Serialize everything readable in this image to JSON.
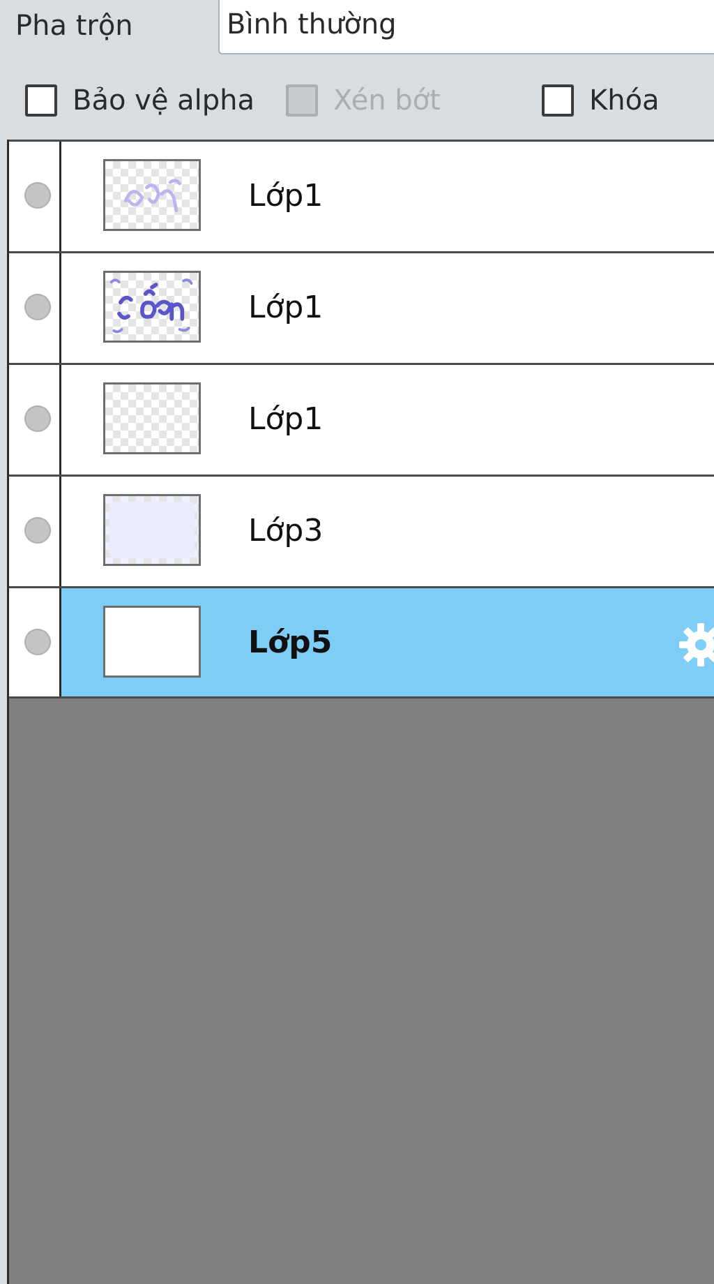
{
  "blend": {
    "label": "Pha trộn",
    "value": "Bình thường"
  },
  "options": {
    "alpha_protect": {
      "label": "Bảo vệ alpha",
      "checked": false,
      "enabled": true
    },
    "clipping": {
      "label": "Xén bớt",
      "checked": false,
      "enabled": false
    },
    "lock": {
      "label": "Khóa",
      "checked": false,
      "enabled": true
    }
  },
  "layers": [
    {
      "name": "Lớp1",
      "thumbnail": "faint purple lettering",
      "selected": false
    },
    {
      "name": "Lớp1",
      "thumbnail": "purple lettering",
      "selected": false
    },
    {
      "name": "Lớp1",
      "thumbnail": "transparent",
      "selected": false
    },
    {
      "name": "Lớp3",
      "thumbnail": "lavender fill",
      "selected": false
    },
    {
      "name": "Lớp5",
      "thumbnail": "white fill",
      "selected": true,
      "icon": "gear-icon"
    }
  ],
  "colors": {
    "selected_row": "#7ecdf7",
    "panel_background": "#d8dde1",
    "empty_area": "#808080"
  }
}
